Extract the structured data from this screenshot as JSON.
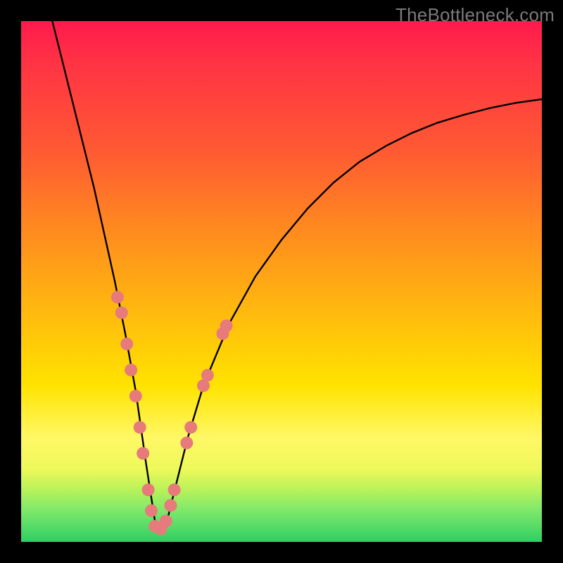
{
  "watermark": "TheBottleneck.com",
  "colors": {
    "gradient_top": "#ff1a4d",
    "gradient_mid": "#ffe300",
    "gradient_bottom": "#30cf63",
    "curve": "#000000",
    "dot": "#e77a7a",
    "frame": "#000000"
  },
  "chart_data": {
    "type": "line",
    "title": "",
    "xlabel": "",
    "ylabel": "",
    "xlim": [
      0,
      100
    ],
    "ylim": [
      0,
      100
    ],
    "description": "Bottleneck curve: V-shaped line over red→green vertical gradient; minimum near x≈26. Sparse pink dots cluster near the valley on both branches.",
    "series": [
      {
        "name": "curve",
        "x": [
          6,
          8,
          10,
          12,
          14,
          16,
          18,
          20,
          22,
          24,
          26,
          28,
          30,
          32,
          35,
          40,
          45,
          50,
          55,
          60,
          65,
          70,
          75,
          80,
          85,
          90,
          95,
          100
        ],
        "y": [
          100,
          92,
          84,
          76,
          68,
          59,
          50,
          40,
          29,
          15,
          2,
          4,
          12,
          20,
          30,
          42,
          51,
          58,
          64,
          69,
          73,
          76,
          78.5,
          80.5,
          82,
          83.3,
          84.3,
          85
        ]
      },
      {
        "name": "dots",
        "points": [
          {
            "x": 18.5,
            "y": 47
          },
          {
            "x": 19.3,
            "y": 44
          },
          {
            "x": 20.3,
            "y": 38
          },
          {
            "x": 21.1,
            "y": 33
          },
          {
            "x": 22.0,
            "y": 28
          },
          {
            "x": 22.8,
            "y": 22
          },
          {
            "x": 23.4,
            "y": 17
          },
          {
            "x": 24.4,
            "y": 10
          },
          {
            "x": 25.0,
            "y": 6
          },
          {
            "x": 25.7,
            "y": 3
          },
          {
            "x": 26.8,
            "y": 2.5
          },
          {
            "x": 27.8,
            "y": 4
          },
          {
            "x": 28.7,
            "y": 7
          },
          {
            "x": 29.4,
            "y": 10
          },
          {
            "x": 31.8,
            "y": 19
          },
          {
            "x": 32.6,
            "y": 22
          },
          {
            "x": 35.0,
            "y": 30
          },
          {
            "x": 35.8,
            "y": 32
          },
          {
            "x": 38.7,
            "y": 40
          },
          {
            "x": 39.4,
            "y": 41.5
          }
        ]
      }
    ]
  }
}
